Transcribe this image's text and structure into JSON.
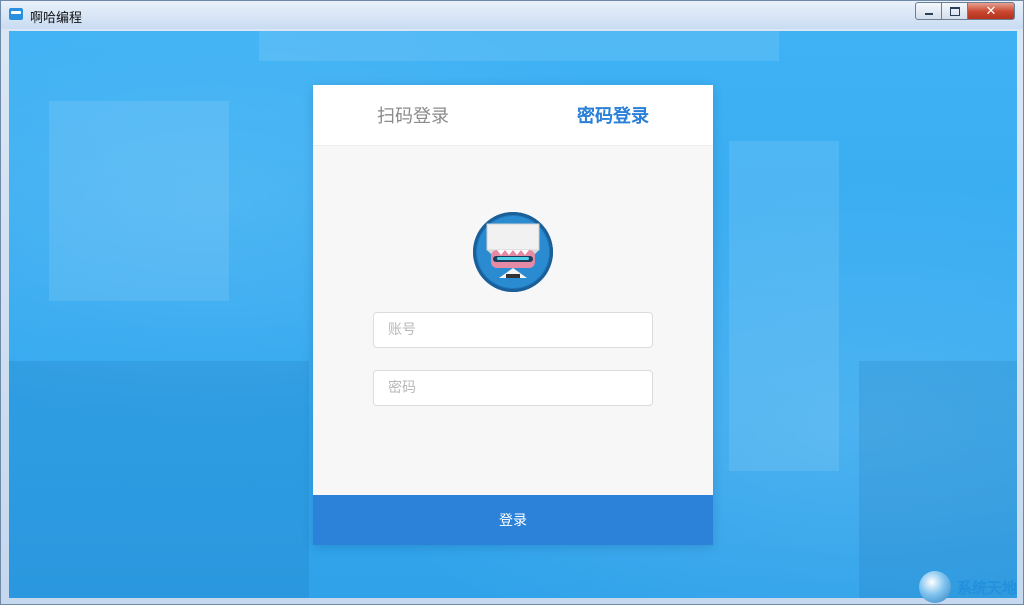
{
  "window": {
    "title": "啊哈编程",
    "controls": {
      "minimize": "minimize",
      "maximize": "maximize",
      "close": "✕"
    }
  },
  "login": {
    "tabs": [
      {
        "label": "扫码登录",
        "active": false
      },
      {
        "label": "密码登录",
        "active": true
      }
    ],
    "account_placeholder": "账号",
    "password_placeholder": "密码",
    "submit_label": "登录"
  },
  "watermark": {
    "text": "系统天地"
  },
  "colors": {
    "background": "#3aaef2",
    "accent": "#2c82d9",
    "active_tab": "#2a7fd8",
    "close_button": "#c9452d"
  },
  "icons": {
    "app": "app-logo-icon",
    "avatar": "robot-mascot-avatar",
    "watermark": "globe-logo-icon"
  }
}
